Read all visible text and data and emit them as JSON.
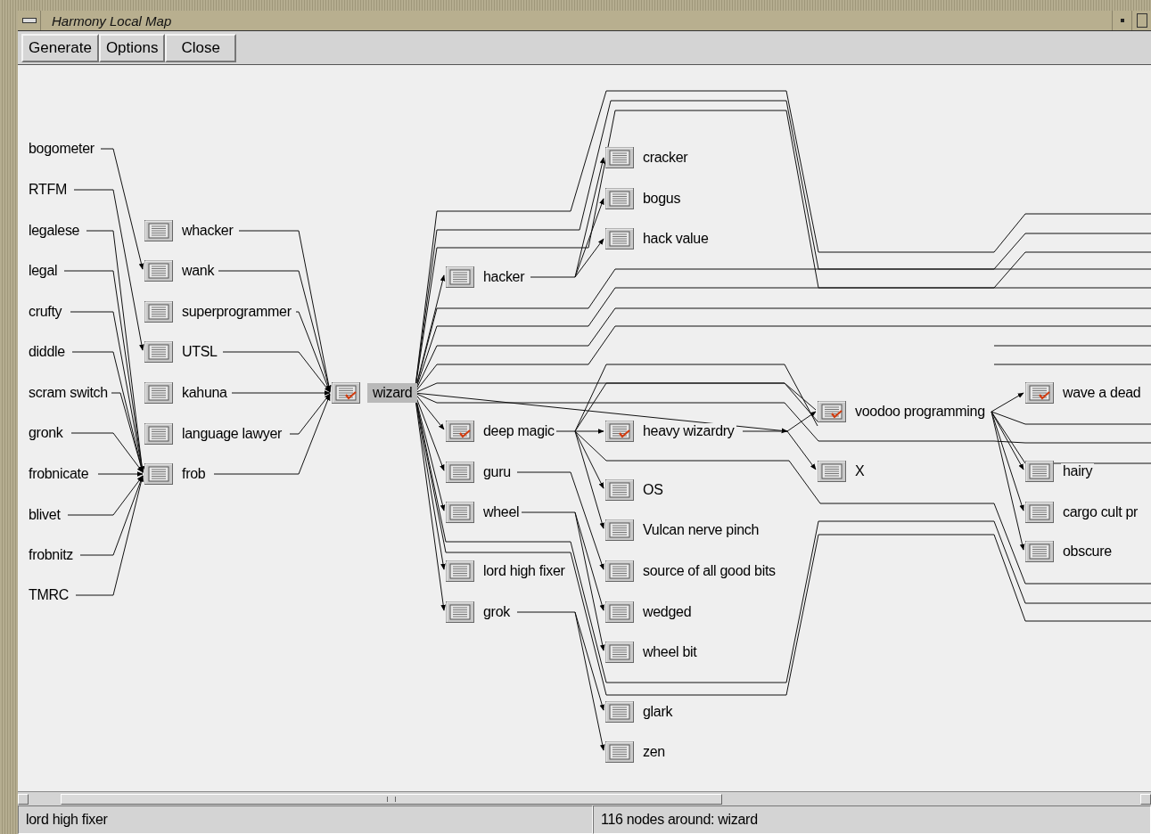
{
  "window": {
    "title": "Harmony Local Map"
  },
  "toolbar": {
    "buttons": [
      "Generate",
      "Options",
      "Close"
    ]
  },
  "map": {
    "nodes": [
      {
        "label": "bogometer",
        "kind": "term",
        "selected": false
      },
      {
        "label": "RTFM",
        "kind": "term",
        "selected": false
      },
      {
        "label": "legalese",
        "kind": "term",
        "selected": false
      },
      {
        "label": "legal",
        "kind": "term",
        "selected": false
      },
      {
        "label": "crufty",
        "kind": "term",
        "selected": false
      },
      {
        "label": "diddle",
        "kind": "term",
        "selected": false
      },
      {
        "label": "scram switch",
        "kind": "term",
        "selected": false
      },
      {
        "label": "gronk",
        "kind": "term",
        "selected": false
      },
      {
        "label": "frobnicate",
        "kind": "term",
        "selected": false
      },
      {
        "label": "blivet",
        "kind": "term",
        "selected": false
      },
      {
        "label": "frobnitz",
        "kind": "term",
        "selected": false
      },
      {
        "label": "TMRC",
        "kind": "term",
        "selected": false
      },
      {
        "label": "whacker",
        "kind": "document",
        "checked": false,
        "selected": false
      },
      {
        "label": "wank",
        "kind": "document",
        "checked": false,
        "selected": false
      },
      {
        "label": "superprogrammer",
        "kind": "document",
        "checked": false,
        "selected": false
      },
      {
        "label": "UTSL",
        "kind": "document",
        "checked": false,
        "selected": false
      },
      {
        "label": "kahuna",
        "kind": "document",
        "checked": false,
        "selected": false
      },
      {
        "label": "language lawyer",
        "kind": "document",
        "checked": false,
        "selected": false
      },
      {
        "label": "frob",
        "kind": "document",
        "checked": false,
        "selected": false
      },
      {
        "label": "wizard",
        "kind": "document",
        "checked": true,
        "selected": true
      },
      {
        "label": "hacker",
        "kind": "document",
        "checked": false,
        "selected": false
      },
      {
        "label": "deep magic",
        "kind": "document",
        "checked": true,
        "selected": false
      },
      {
        "label": "guru",
        "kind": "document",
        "checked": false,
        "selected": false
      },
      {
        "label": "wheel",
        "kind": "document",
        "checked": false,
        "selected": false
      },
      {
        "label": "lord high fixer",
        "kind": "document",
        "checked": false,
        "selected": false
      },
      {
        "label": "grok",
        "kind": "document",
        "checked": false,
        "selected": false
      },
      {
        "label": "cracker",
        "kind": "document",
        "checked": false,
        "selected": false
      },
      {
        "label": "bogus",
        "kind": "document",
        "checked": false,
        "selected": false
      },
      {
        "label": "hack value",
        "kind": "document",
        "checked": false,
        "selected": false
      },
      {
        "label": "heavy wizardry",
        "kind": "document",
        "checked": true,
        "selected": false
      },
      {
        "label": "OS",
        "kind": "document",
        "checked": false,
        "selected": false
      },
      {
        "label": "Vulcan nerve pinch",
        "kind": "document",
        "checked": false,
        "selected": false
      },
      {
        "label": "source of all good bits",
        "kind": "document",
        "checked": false,
        "selected": false
      },
      {
        "label": "wedged",
        "kind": "document",
        "checked": false,
        "selected": false
      },
      {
        "label": "wheel bit",
        "kind": "document",
        "checked": false,
        "selected": false
      },
      {
        "label": "glark",
        "kind": "document",
        "checked": false,
        "selected": false
      },
      {
        "label": "zen",
        "kind": "document",
        "checked": false,
        "selected": false
      },
      {
        "label": "voodoo programming",
        "kind": "document",
        "checked": true,
        "selected": false
      },
      {
        "label": "X",
        "kind": "document",
        "checked": false,
        "selected": false
      },
      {
        "label": "wave a dead",
        "kind": "document",
        "checked": true,
        "selected": false
      },
      {
        "label": "hairy",
        "kind": "document",
        "checked": false,
        "selected": false
      },
      {
        "label": "cargo cult pr",
        "kind": "document",
        "checked": false,
        "selected": false
      },
      {
        "label": "obscure",
        "kind": "document",
        "checked": false,
        "selected": false
      }
    ]
  },
  "status_bar": {
    "fields": [
      "lord high fixer",
      "116 nodes around: wizard"
    ]
  }
}
